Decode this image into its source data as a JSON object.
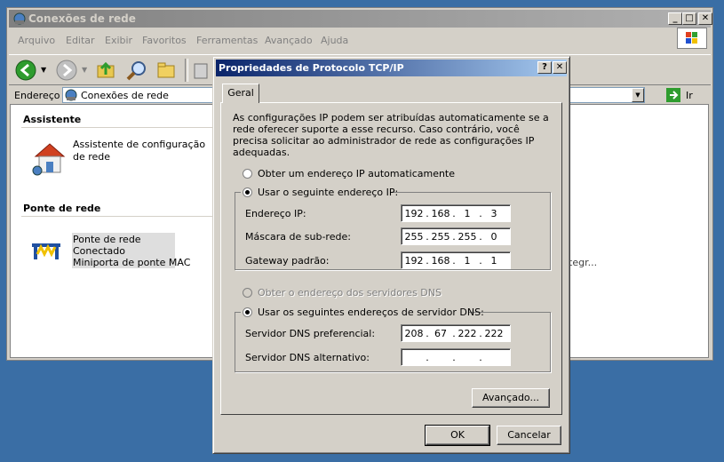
{
  "explorer": {
    "title": "Conexões de rede",
    "menu": [
      "Arquivo",
      "Editar",
      "Exibir",
      "Favoritos",
      "Ferramentas",
      "Avançado",
      "Ajuda"
    ],
    "address_label": "Endereço",
    "address_value": "Conexões de rede",
    "go_label": "Ir",
    "sections": {
      "assistente": {
        "title": "Assistente",
        "item_label": "Assistente de configuração de rede"
      },
      "ponte": {
        "title": "Ponte de rede",
        "item_name": "Ponte de rede",
        "item_status": "Conectado",
        "item_device": "Miniporta de ponte MAC"
      }
    },
    "truncated_text": "tegr..."
  },
  "dialog": {
    "title": "Propriedades de Protocolo TCP/IP",
    "tab": "Geral",
    "intro": "As configurações IP podem ser atribuídas automaticamente se a rede oferecer suporte a esse recurso. Caso contrário, você precisa solicitar ao administrador de rede as configurações IP adequadas.",
    "radio_auto_ip": "Obter um endereço IP automaticamente",
    "radio_manual_ip": "Usar o seguinte endereço IP:",
    "ip_label": "Endereço IP:",
    "ip": [
      "192",
      "168",
      "1",
      "3"
    ],
    "mask_label": "Máscara de sub-rede:",
    "mask": [
      "255",
      "255",
      "255",
      "0"
    ],
    "gateway_label": "Gateway padrão:",
    "gateway": [
      "192",
      "168",
      "1",
      "1"
    ],
    "radio_auto_dns": "Obter o endereço dos servidores DNS",
    "radio_manual_dns": "Usar os seguintes endereços de servidor DNS:",
    "dns_pref_label": "Servidor DNS preferencial:",
    "dns_pref": [
      "208",
      "67",
      "222",
      "222"
    ],
    "dns_alt_label": "Servidor DNS alternativo:",
    "dns_alt": [
      "",
      "",
      "",
      ""
    ],
    "advanced_button": "Avançado...",
    "ok_button": "OK",
    "cancel_button": "Cancelar"
  },
  "colors": {
    "desktop": "#3a6ea5",
    "active_title_start": "#0a246a",
    "active_title_end": "#a6caf0",
    "inactive_title": "#808080"
  }
}
